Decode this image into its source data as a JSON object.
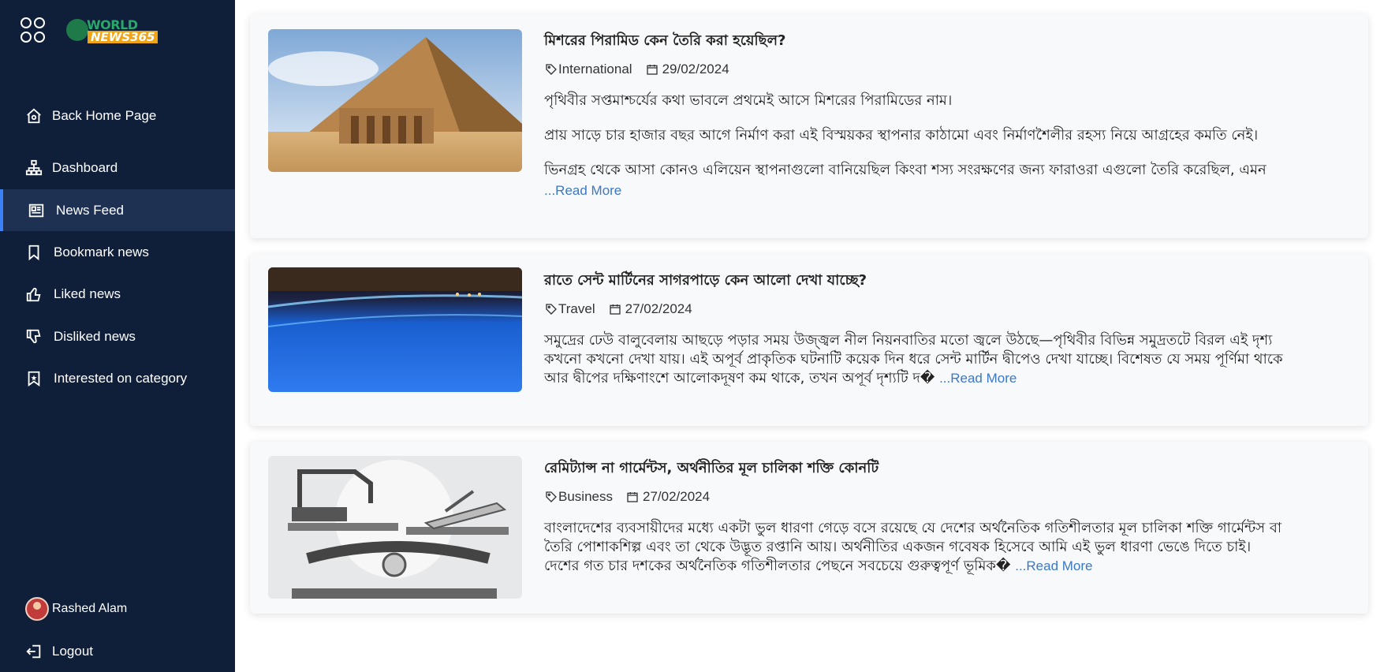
{
  "sidebar": {
    "logo": {
      "line1": "WORLD",
      "line2": "NEWS365"
    },
    "items": [
      {
        "label": "Back Home Page",
        "icon": "home-icon"
      },
      {
        "label": "Dashboard",
        "icon": "sitemap-icon"
      },
      {
        "label": "News Feed",
        "icon": "newspaper-icon",
        "active": true
      },
      {
        "label": "Bookmark news",
        "icon": "bookmark-icon"
      },
      {
        "label": "Liked news",
        "icon": "thumbs-up-icon"
      },
      {
        "label": "Disliked news",
        "icon": "thumbs-down-icon"
      },
      {
        "label": "Interested on category",
        "icon": "bookmark-star-icon"
      }
    ],
    "user": {
      "name": "Rashed Alam"
    },
    "logout": "Logout"
  },
  "colors": {
    "sidebar_bg": "#0f1f3a",
    "active_bg": "#1f3152",
    "accent": "#3b82f6",
    "link": "#3b78c7"
  },
  "articles": [
    {
      "title": "মিশরের পিরামিড কেন তৈরি করা হয়েছিল?",
      "category": "International",
      "date": "29/02/2024",
      "paragraphs": [
        "পৃথিবীর সপ্তমাশ্চর্যের কথা ভাবলে প্রথমেই আসে মিশরের পিরামিডের নাম।",
        "প্রায় সাড়ে চার হাজার বছর আগে নির্মাণ করা এই বিস্ময়কর স্থাপনার কাঠামো এবং নির্মাণশৈলীর রহস্য নিয়ে আগ্রহের কমতি নেই।",
        "ভিনগ্রহ থেকে আসা কোনও এলিয়েন স্থাপনাগুলো বানিয়েছিল কিংবা শস্য সংরক্ষণের জন্য ফারাওরা এগুলো তৈরি করেছিল, এমন"
      ],
      "read_more": "...Read More"
    },
    {
      "title": "রাতে সেন্ট মার্টিনের সাগরপাড়ে কেন আলো দেখা যাচ্ছে?",
      "category": "Travel",
      "date": "27/02/2024",
      "lines": [
        "সমুদ্রের ঢেউ বালুবেলায় আছড়ে পড়ার সময় উজ্জ্বল নীল নিয়নবাতির মতো জ্বলে উঠছে—পৃথিবীর বিভিন্ন সমুদ্রতটে বিরল এই দৃশ্য",
        "কখনো কখনো দেখা যায়। এই অপূর্ব প্রাকৃতিক ঘটনাটি কয়েক দিন ধরে সেন্ট মার্টিন দ্বীপেও দেখা যাচ্ছে। বিশেষত যে সময় পূর্ণিমা থাকে",
        "আর দ্বীপের দক্ষিণাংশে আলোকদূষণ কম থাকে, তখন অপূর্ব দৃশ্যটি দ�"
      ],
      "read_more": "...Read More"
    },
    {
      "title": "রেমিট্যান্স না গার্মেন্টস, অর্থনীতির মূল চালিকা শক্তি কোনটি",
      "category": "Business",
      "date": "27/02/2024",
      "lines": [
        "বাংলাদেশের ব্যবসায়ীদের মধ্যে একটা ভুল ধারণা গেড়ে বসে রয়েছে যে দেশের অর্থনৈতিক গতিশীলতার মূল চালিকা শক্তি গার্মেন্টস বা",
        "তৈরি পোশাকশিল্প এবং তা থেকে উদ্ভূত রপ্তানি আয়। অর্থনীতির একজন গবেষক হিসেবে আমি এই ভুল ধারণা ভেঙে দিতে চাই।",
        "দেশের গত চার দশকের অর্থনৈতিক গতিশীলতার পেছনে সবচেয়ে গুরুত্বপূর্ণ ভূমিক�"
      ],
      "read_more": "...Read More"
    }
  ]
}
